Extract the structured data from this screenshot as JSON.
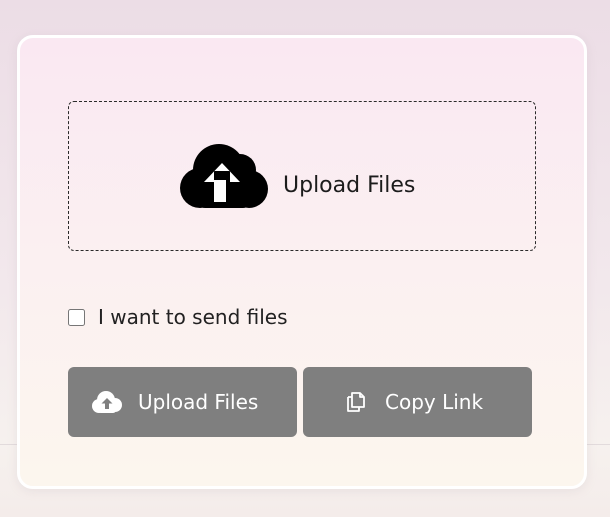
{
  "dropzone": {
    "icon": "cloud-upload-icon",
    "label": "Upload Files"
  },
  "send_option": {
    "label": "I want to send files",
    "checked": false
  },
  "buttons": {
    "upload": {
      "icon": "cloud-upload-icon",
      "label": "Upload Files"
    },
    "copy": {
      "icon": "copy-icon",
      "label": "Copy Link"
    }
  },
  "colors": {
    "button_background": "#7f7f7f",
    "button_text": "#ffffff",
    "icon_dark": "#000000",
    "card_border": "#ffffff"
  }
}
